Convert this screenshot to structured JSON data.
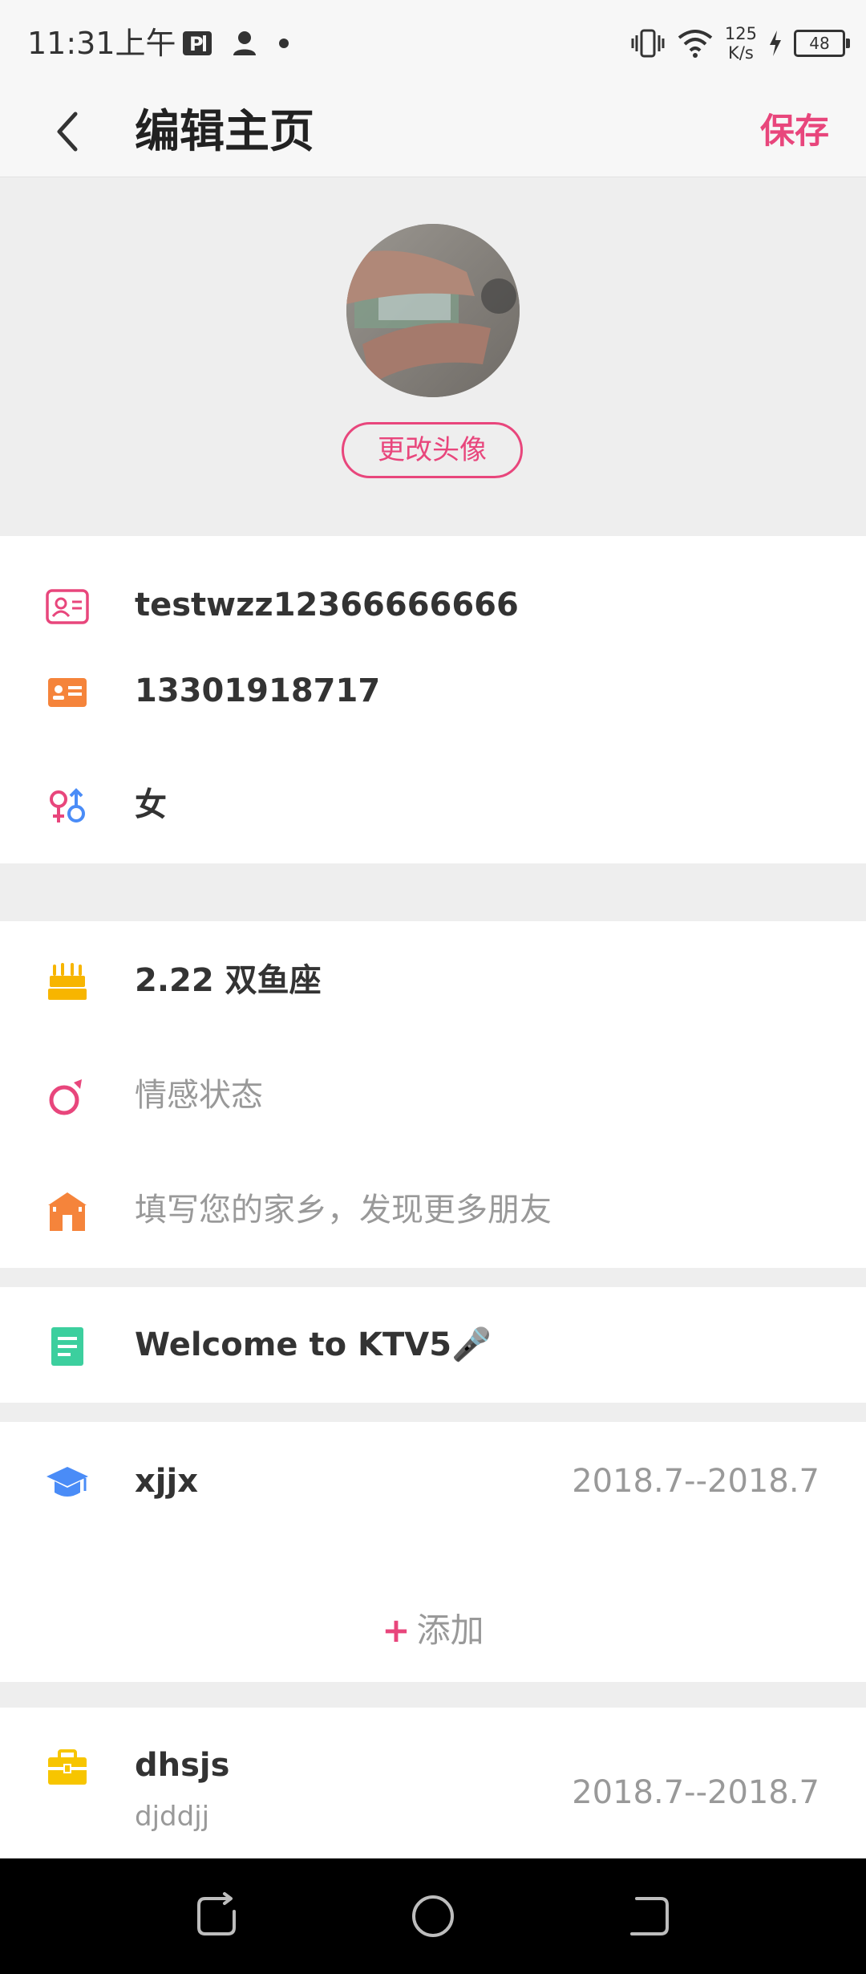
{
  "status_bar": {
    "time": "11:31上午",
    "net_speed_value": "125",
    "net_speed_unit": "K/s",
    "battery": "48"
  },
  "nav": {
    "title": "编辑主页",
    "save_label": "保存"
  },
  "avatar": {
    "change_label": "更改头像"
  },
  "profile": {
    "nickname": "testwzz12366666666",
    "phone": "13301918717",
    "gender": "女"
  },
  "details": {
    "birthday": "2.22 双鱼座",
    "relationship_placeholder": "情感状态",
    "hometown_placeholder": "填写您的家乡，发现更多朋友"
  },
  "signature": {
    "text": "Welcome to KTV5🎤"
  },
  "education": {
    "school": "xjjx",
    "period": "2018.7--2018.7",
    "add_label": "添加",
    "add_plus": "+"
  },
  "work": {
    "company": "dhsjs",
    "position": "djddjj",
    "period": "2018.7--2018.7"
  },
  "colors": {
    "accent": "#e8467c",
    "birthday_icon": "#f7b500",
    "hometown_icon": "#f5843b",
    "signature_icon": "#3ccf9e",
    "education_icon": "#4a8cf7",
    "work_icon": "#f7c500",
    "phone_icon": "#f5843b"
  }
}
